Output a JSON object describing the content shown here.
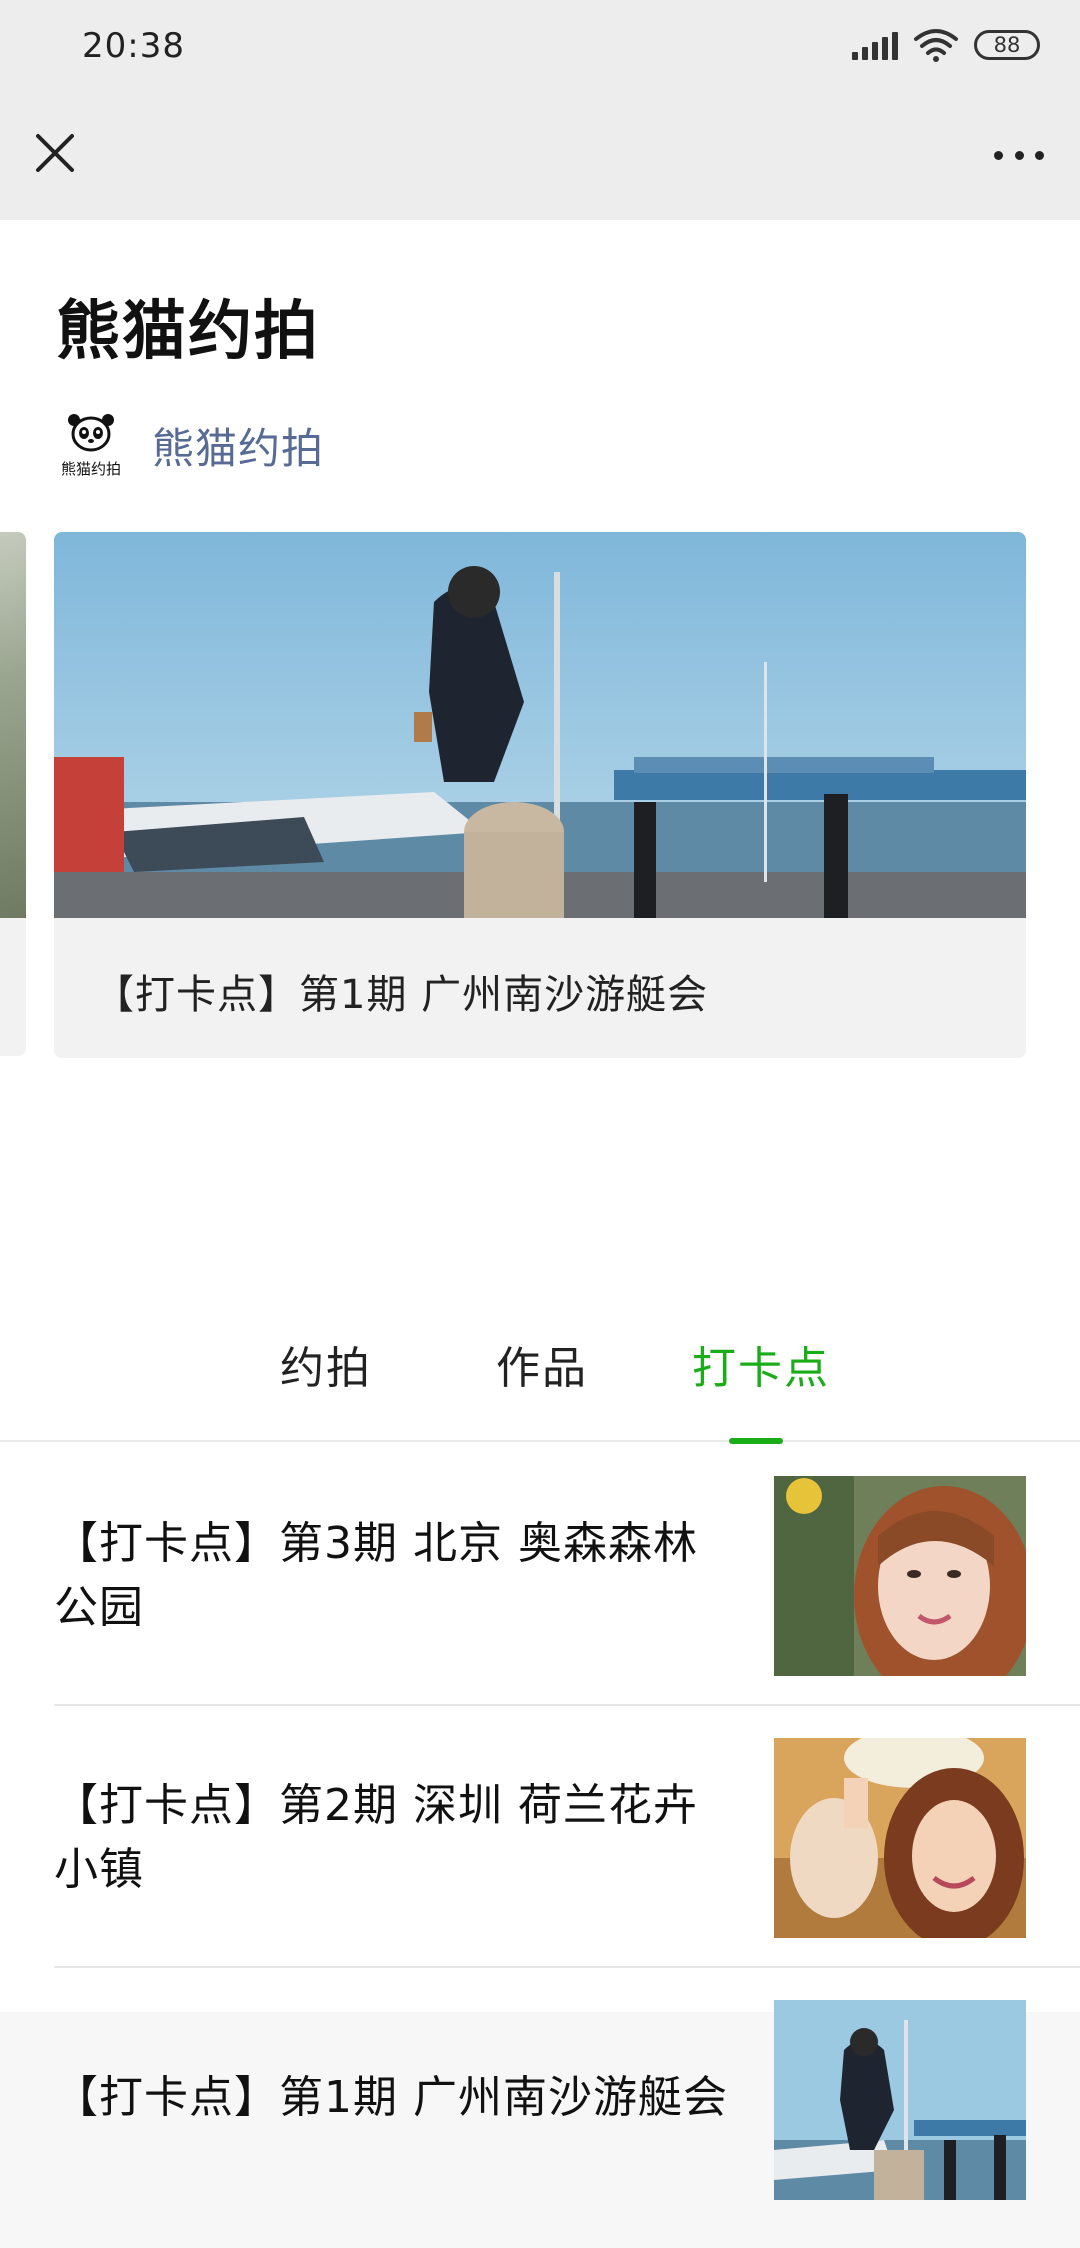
{
  "status_bar": {
    "time": "20:38",
    "battery": "88"
  },
  "header": {
    "title": "熊猫约拍"
  },
  "account": {
    "avatar_caption": "熊猫约拍",
    "name": "熊猫约拍"
  },
  "carousel": {
    "featured_caption": "【打卡点】第1期 广州南沙游艇会"
  },
  "tabs": [
    {
      "label": "约拍",
      "active": false
    },
    {
      "label": "作品",
      "active": false
    },
    {
      "label": "打卡点",
      "active": true
    }
  ],
  "articles": [
    {
      "title": "【打卡点】第3期 北京 奥森森林公园"
    },
    {
      "title": "【打卡点】第2期 深圳 荷兰花卉小镇"
    },
    {
      "title": "【打卡点】第1期 广州南沙游艇会"
    }
  ],
  "colors": {
    "accent": "#1aad19",
    "link": "#576b95",
    "header_bg": "#ededed"
  }
}
